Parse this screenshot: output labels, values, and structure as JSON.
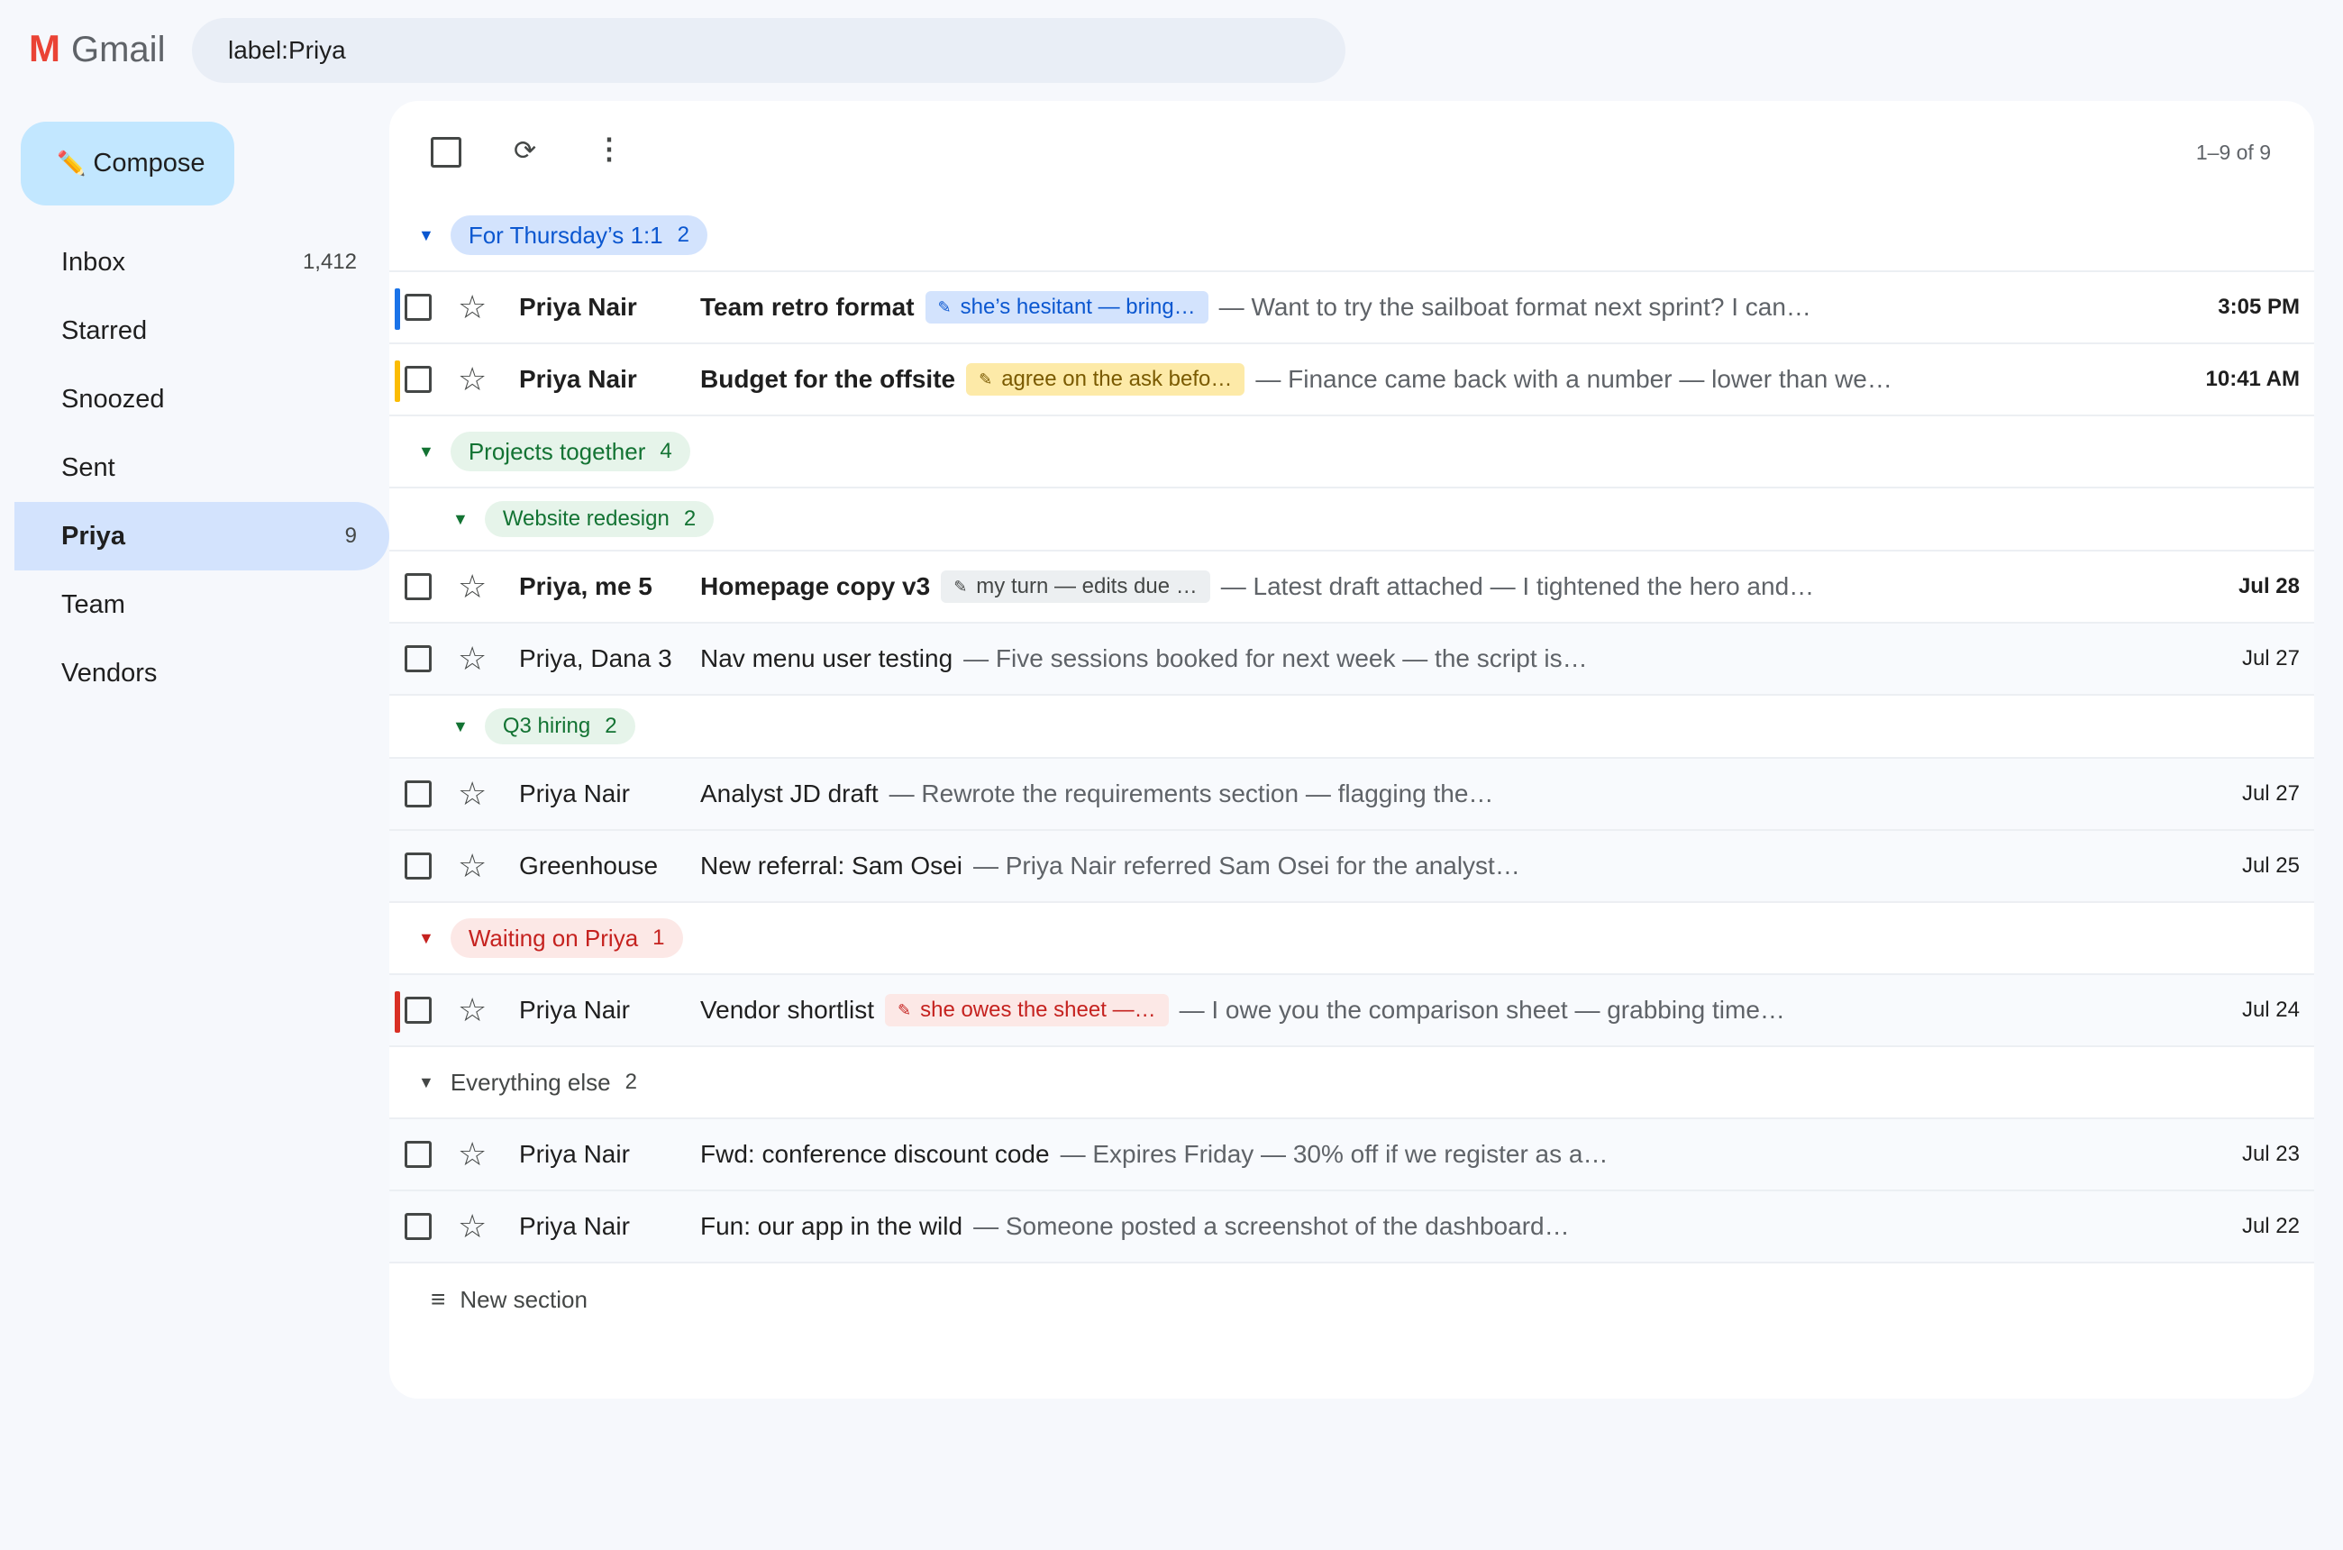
{
  "app": {
    "logo_letter": "M",
    "name": "Gmail"
  },
  "search": {
    "query": "label:Priya"
  },
  "compose": {
    "icon": "✏️",
    "label": "Compose"
  },
  "nav": [
    {
      "label": "Inbox",
      "count": "1,412"
    },
    {
      "label": "Starred",
      "count": ""
    },
    {
      "label": "Snoozed",
      "count": ""
    },
    {
      "label": "Sent",
      "count": ""
    },
    {
      "label": "Priya",
      "count": "9",
      "active": true
    },
    {
      "label": "Team",
      "count": ""
    },
    {
      "label": "Vendors",
      "count": ""
    }
  ],
  "toolbar": {
    "range": "1–9 of 9",
    "refresh_icon": "⟳",
    "more_icon": "⋮"
  },
  "sections": [
    {
      "type": "section",
      "title": "For Thursday’s 1:1",
      "count": "2",
      "color": "#0b57d0",
      "bg": "#d3e3fd",
      "rows": [
        {
          "bar": "#1a73e8",
          "unread": true,
          "sender": "Priya Nair",
          "subject": "Team retro format",
          "note": "she’s hesitant — bring…",
          "note_color": "#0b57d0",
          "note_bg": "#d3e3fd",
          "snippet": "— Want to try the sailboat format next sprint? I can…",
          "date": "3:05 PM"
        },
        {
          "bar": "#fbbc04",
          "unread": true,
          "sender": "Priya Nair",
          "subject": "Budget for the offsite",
          "note": "agree on the ask befo…",
          "note_color": "#7a5a00",
          "note_bg": "#fdeaa8",
          "snippet": "— Finance came back with a number — lower than we…",
          "date": "10:41 AM"
        }
      ]
    },
    {
      "type": "section",
      "title": "Projects together",
      "count": "4",
      "color": "#137333",
      "bg": "#e6f4ea",
      "rows": []
    },
    {
      "type": "subsection",
      "title": "Website redesign",
      "count": "2",
      "color": "#137333",
      "bg": "#e6f4ea",
      "rows": [
        {
          "bar": "",
          "unread": true,
          "sender": "Priya, me 5",
          "subject": "Homepage copy v3",
          "note": "my turn — edits due …",
          "note_color": "#444746",
          "note_bg": "#eceff1",
          "snippet": "— Latest draft attached — I tightened the hero and…",
          "date": "Jul 28"
        },
        {
          "bar": "",
          "unread": false,
          "sender": "Priya, Dana 3",
          "subject": "Nav menu user testing",
          "note": "",
          "snippet": "— Five sessions booked for next week — the script is…",
          "date": "Jul 27"
        }
      ]
    },
    {
      "type": "subsection",
      "title": "Q3 hiring",
      "count": "2",
      "color": "#137333",
      "bg": "#e6f4ea",
      "rows": [
        {
          "bar": "",
          "unread": false,
          "sender": "Priya Nair",
          "subject": "Analyst JD draft",
          "note": "",
          "snippet": "— Rewrote the requirements section — flagging the…",
          "date": "Jul 27"
        },
        {
          "bar": "",
          "unread": false,
          "sender": "Greenhouse",
          "subject": "New referral: Sam Osei",
          "note": "",
          "snippet": "— Priya Nair referred Sam Osei for the analyst…",
          "date": "Jul 25"
        }
      ]
    },
    {
      "type": "section",
      "title": "Waiting on Priya",
      "count": "1",
      "color": "#c5221f",
      "bg": "#fce8e6",
      "rows": [
        {
          "bar": "#d93025",
          "unread": false,
          "sender": "Priya Nair",
          "subject": "Vendor shortlist",
          "note": "she owes the sheet —…",
          "note_color": "#c5221f",
          "note_bg": "#fce8e6",
          "snippet": "— I owe you the comparison sheet — grabbing time…",
          "date": "Jul 24"
        }
      ]
    },
    {
      "type": "section",
      "title": "Everything else",
      "count": "2",
      "color": "#444746",
      "bg": "transparent",
      "rows": [
        {
          "bar": "",
          "unread": false,
          "sender": "Priya Nair",
          "subject": "Fwd: conference discount code",
          "note": "",
          "snippet": "— Expires Friday — 30% off if we register as a…",
          "date": "Jul 23"
        },
        {
          "bar": "",
          "unread": false,
          "sender": "Priya Nair",
          "subject": "Fun: our app in the wild",
          "note": "",
          "snippet": "— Someone posted a screenshot of the dashboard…",
          "date": "Jul 22"
        }
      ]
    }
  ],
  "new_section": {
    "icon": "≡",
    "label": "New section"
  }
}
